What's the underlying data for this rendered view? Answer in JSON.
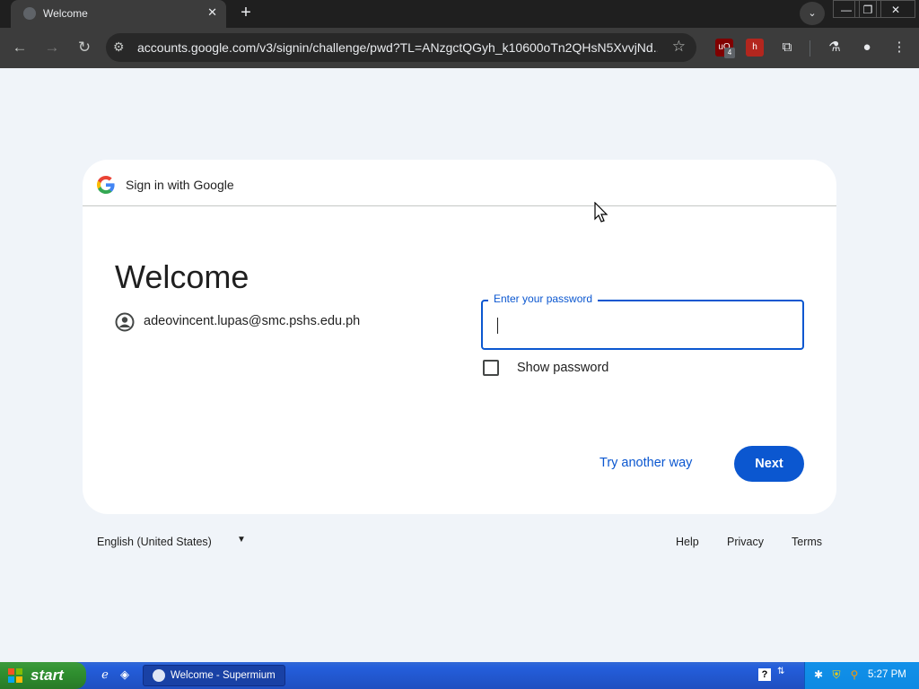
{
  "browser": {
    "tab_title": "Welcome",
    "url": "accounts.google.com/v3/signin/challenge/pwd?TL=ANzgctQGyh_k10600oTn2QHsN5XvvjNd...",
    "extensions": [
      {
        "name": "ublock-extension",
        "badge": "4",
        "color": "#800000"
      },
      {
        "name": "red-extension",
        "color": "#b3261e"
      }
    ]
  },
  "card": {
    "header_text": "Sign in with Google",
    "welcome": "Welcome",
    "email": "adeovincent.lupas@smc.pshs.edu.ph",
    "password_label": "Enter your password",
    "show_password": "Show password",
    "try_another": "Try another way",
    "next": "Next"
  },
  "footer": {
    "language": "English (United States)",
    "links": [
      "Help",
      "Privacy",
      "Terms"
    ]
  },
  "taskbar": {
    "start": "start",
    "task_label": "Welcome - Supermium",
    "clock": "5:27 PM"
  },
  "colors": {
    "accent": "#0b57d0",
    "page_bg": "#f0f4f9",
    "taskbar_blue": "#245edb",
    "start_green": "#2f8f2f"
  }
}
